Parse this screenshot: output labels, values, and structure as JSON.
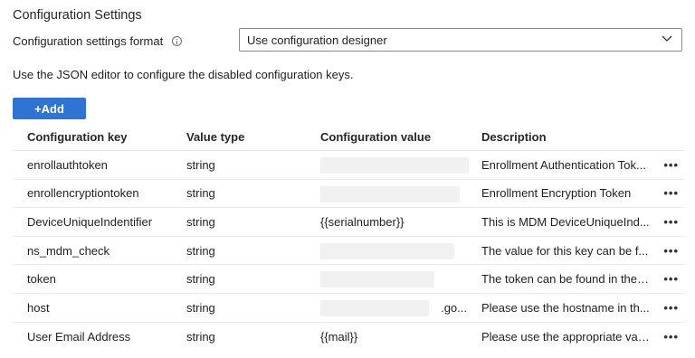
{
  "header": {
    "title": "Configuration Settings",
    "format_label": "Configuration settings format",
    "format_value": "Use configuration designer",
    "help_text": "Use the JSON editor to configure the disabled configuration keys.",
    "add_label": "+Add"
  },
  "table": {
    "columns": [
      "Configuration key",
      "Value type",
      "Configuration value",
      "Description"
    ],
    "rows": [
      {
        "key": "enrollauthtoken",
        "type": "string",
        "value": "",
        "description": "Enrollment Authentication Tok..."
      },
      {
        "key": "enrollencryptiontoken",
        "type": "string",
        "value": "",
        "description": "Enrollment Encryption Token"
      },
      {
        "key": "DeviceUniqueIndentifier",
        "type": "string",
        "value": "{{serialnumber}}",
        "description": "This is MDM DeviceUniqueInd..."
      },
      {
        "key": "ns_mdm_check",
        "type": "string",
        "value": "",
        "description": "The value for this key can be f..."
      },
      {
        "key": "token",
        "type": "string",
        "value": "",
        "description": "The token can be found in the ..."
      },
      {
        "key": "host",
        "type": "string",
        "value": ".go...",
        "description": "Please use the hostname in th..."
      },
      {
        "key": "User Email Address",
        "type": "string",
        "value": "{{mail}}",
        "description": "Please use the appropriate vari..."
      }
    ]
  },
  "icons": {
    "info": "info-icon",
    "chevron": "chevron-down-icon",
    "more": "more-options-icon",
    "more_glyph": "•••"
  },
  "colors": {
    "accent": "#2f74d0",
    "redacted": "#f1f1f1"
  }
}
